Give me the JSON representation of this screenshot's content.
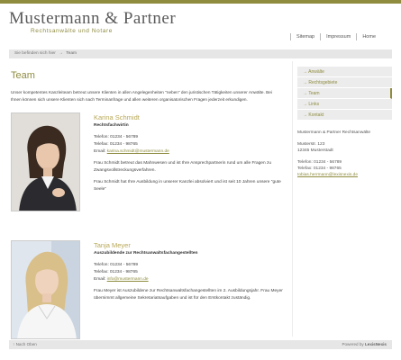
{
  "header": {
    "logo_title": "Mustermann & Partner",
    "logo_subtitle": "Rechtsanwälte und Notare",
    "top_nav": [
      "Sitemap",
      "Impressum",
      "Home"
    ]
  },
  "breadcrumb": {
    "prefix": "Sie befinden sich hier",
    "separator": "→",
    "current": "Team"
  },
  "main": {
    "title": "Team",
    "intro": "Unser kompetentes Kanzleiteam betreut unsere Klienten in allen Angelegenheiten \"neben\" den juristischen Tätigkeiten unserer Anwälte. Bei Ihnen können sich unsere Klienten sich nach Terminanfrage und allen weiteren organisatorischen Fragen jederzeit erkundigen.",
    "people": [
      {
        "name": "Karina Schmidt",
        "role": "Rechtsfachwirtin",
        "phone": "Telefon: 01234 - 56789",
        "fax": "Telefax: 01234 - 98765",
        "email_label": "Email:",
        "email": "karina.schmidt@mustermann.de",
        "paragraphs": [
          "Frau Schmidt betreut das Mahnwesen und ist Ihre Ansprechpartnerin rund um alle Fragen zu Zwangsvollstreckungsverfahren.",
          "Frau Schmidt hat Ihre Ausbildung in unserer Kanzlei absolviert und ist seit 10 Jahren unsere \"gute Seele\""
        ]
      },
      {
        "name": "Tanja Meyer",
        "role": "Auszubildende zur Rechtsanwaltsfachangestellten",
        "phone": "Telefon: 01234 - 56789",
        "fax": "Telefax: 01234 - 98765",
        "email_label": "Email:",
        "email": "info@mustermann.de",
        "paragraphs": [
          "Frau Meyer ist Auszubildene zur Rechtsanwaltsfachangestellten im 2. Ausbildungsjahr. Frau Meyer übernimmt allgemeine Sekretariatsaufgaben und ist für den Erstkontakt zuständig."
        ]
      }
    ]
  },
  "sidebar": {
    "nav": [
      {
        "label": "Anwälte",
        "active": false
      },
      {
        "label": "Rechtsgebiete",
        "active": false
      },
      {
        "label": "Team",
        "active": true
      },
      {
        "label": "Links",
        "active": false
      },
      {
        "label": "Kontakt",
        "active": false
      }
    ],
    "nav_arrow": "→",
    "contact": {
      "firm": "Mustermann & Partner Rechtsanwälte",
      "street": "Musterstr. 123",
      "city": "12345 Musterstadt",
      "phone": "Telefon: 01234 - 56789",
      "fax": "Telefax: 01234 - 98765",
      "email": "tobias.herrmann@lexisnexis.de"
    }
  },
  "footer": {
    "top_link": "↑ Nach Oben",
    "powered_by": "Powered by",
    "brand": "LexisNexis"
  },
  "colors": {
    "accent": "#8f8c40",
    "name": "#b8a857",
    "bar": "#e6e6e6"
  }
}
